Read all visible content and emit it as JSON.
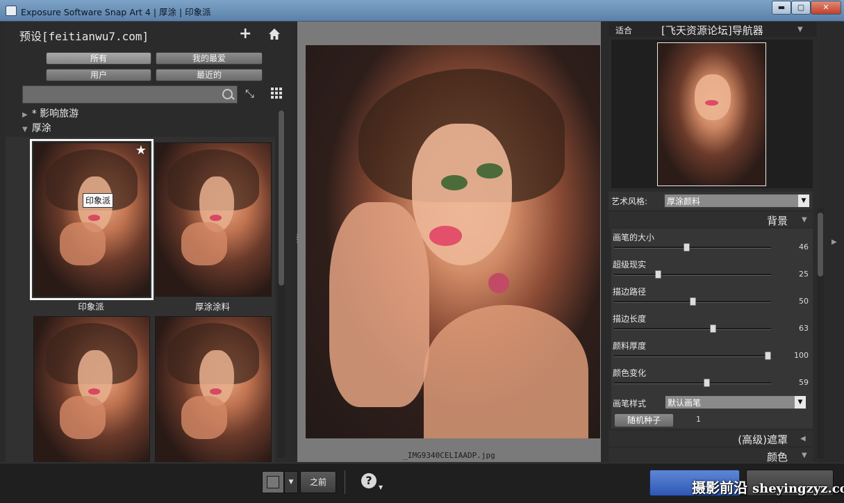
{
  "window": {
    "title": "Exposure Software Snap Art 4 | 厚涂 | 印象派",
    "minimize_glyph": "▬",
    "maximize_glyph": "▢",
    "close_glyph": "✕"
  },
  "presets": {
    "title": "预设[feitianwu7.com]",
    "add_glyph": "+",
    "filters": {
      "all": "所有",
      "favorites": "我的最爱",
      "user": "用户",
      "recent": "最近的"
    },
    "tree": [
      {
        "label": "* 影响旅游",
        "expanded": false
      },
      {
        "label": "厚涂",
        "expanded": true
      }
    ],
    "thumbnails": [
      {
        "label": "印象派",
        "selected": true,
        "favorite": true
      },
      {
        "label": "厚涂涂料",
        "selected": false,
        "favorite": false
      },
      {
        "label": "",
        "selected": false,
        "favorite": false
      },
      {
        "label": "",
        "selected": false,
        "favorite": false
      }
    ],
    "tooltip": "印象派"
  },
  "preview": {
    "filename": "_IMG9340CELIAADP.jpg"
  },
  "navigator": {
    "fit_label": "适合",
    "title": "[飞天资源论坛]导航器"
  },
  "art_style": {
    "label": "艺术风格:",
    "value": "厚涂颜料"
  },
  "background_section": {
    "title": "背景"
  },
  "sliders": [
    {
      "label": "画笔的大小",
      "value": 46,
      "fraction": 0.46
    },
    {
      "label": "超级现实",
      "value": 25,
      "fraction": 0.28
    },
    {
      "label": "描边路径",
      "value": 50,
      "fraction": 0.5
    },
    {
      "label": "描边长度",
      "value": 63,
      "fraction": 0.63
    },
    {
      "label": "颜料厚度",
      "value": 100,
      "fraction": 0.98
    },
    {
      "label": "颜色变化",
      "value": 59,
      "fraction": 0.59
    }
  ],
  "brush_style": {
    "label": "画笔样式",
    "value": "默认画笔"
  },
  "random_seed": {
    "label": "随机种子",
    "value": "1"
  },
  "sections": {
    "advanced_mask": "(高级)遮罩",
    "color": "颜色"
  },
  "bottom": {
    "before_label": "之前",
    "help_glyph": "?",
    "ok_label": "",
    "cancel_label": ""
  },
  "watermark": {
    "text": "摄影前沿",
    "site": "sheyingzyz.com"
  },
  "colors": {
    "accent_blue": "#3a64c0",
    "panel": "#2b2b2b",
    "titlebar": "#6d92b8"
  }
}
